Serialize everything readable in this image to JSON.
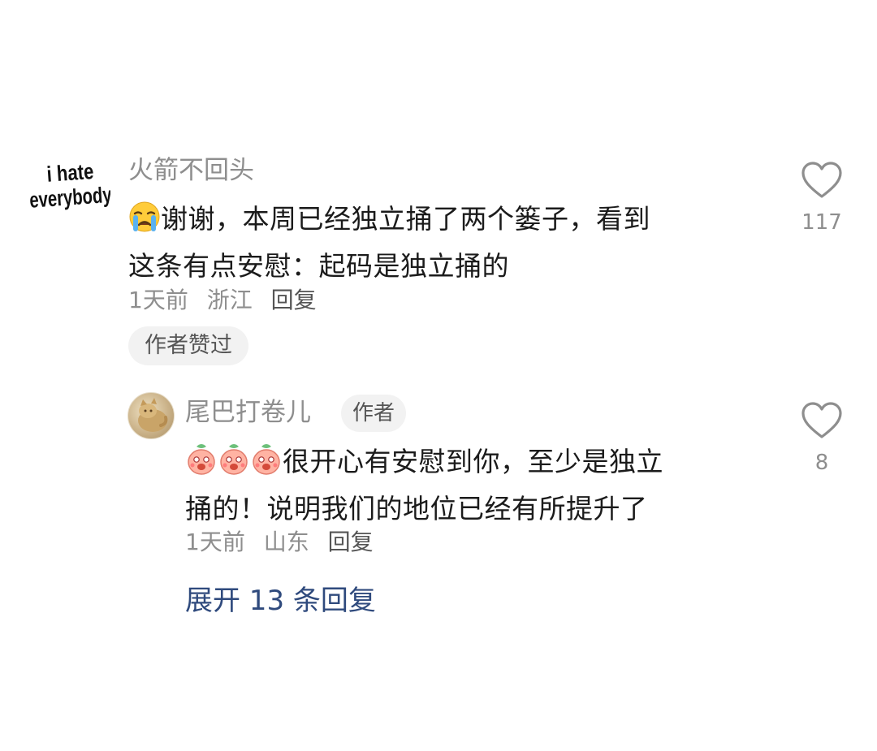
{
  "main_comment": {
    "avatar_text": [
      "i hate",
      "everybody"
    ],
    "username": "火箭不回头",
    "text_line1": "谢谢，本周已经独立捅了两个篓子，看到",
    "text_line2": "这条有点安慰：起码是独立捅的",
    "emoji": "crying-face-icon",
    "time": "1天前",
    "location": "浙江",
    "reply_label": "回复",
    "liked_badge": "作者赞过",
    "like_count": "117"
  },
  "reply_comment": {
    "username": "尾巴打卷儿",
    "author_badge": "作者",
    "text_line1": "很开心有安慰到你，至少是独立",
    "text_line2": "捅的！说明我们的地位已经有所提升了",
    "time": "1天前",
    "location": "山东",
    "reply_label": "回复",
    "like_count": "8"
  },
  "expand_label": "展开 13 条回复",
  "colors": {
    "username": "#8e8e8e",
    "expand_link": "#2f4a7d",
    "badge_bg": "#f2f2f2"
  }
}
